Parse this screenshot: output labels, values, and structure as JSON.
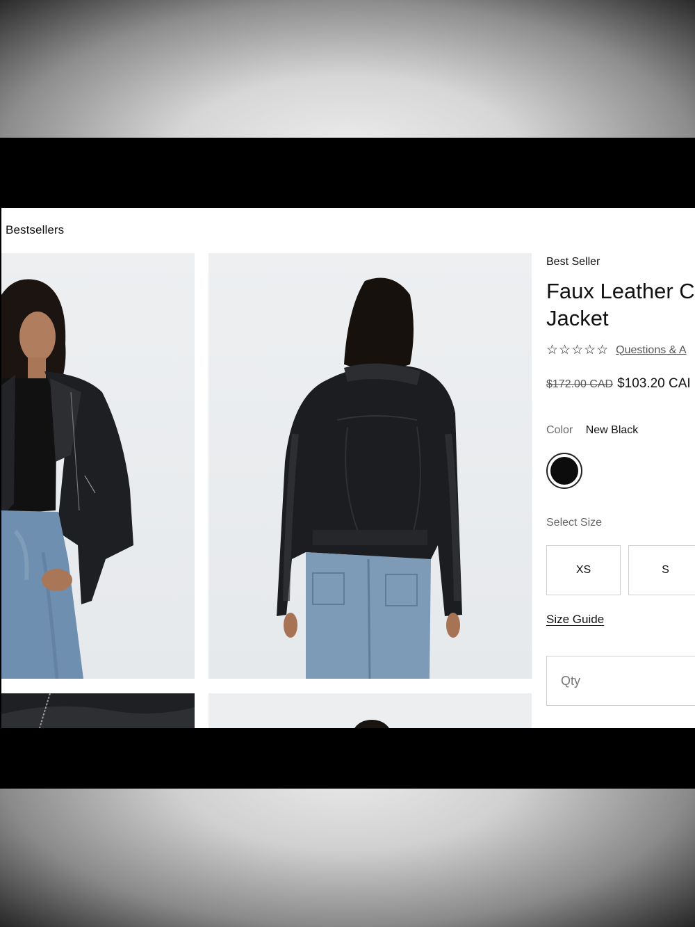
{
  "breadcrumb": {
    "label": "Bestsellers"
  },
  "product": {
    "badge": "Best Seller",
    "title_line1": "Faux Leather C",
    "title_line2": "Jacket",
    "rating_stars": "☆☆☆☆☆",
    "questions_link": "Questions & A",
    "original_price": "$172.00 CAD",
    "sale_price": "$103.20 CAI",
    "color_label": "Color",
    "color_value": "New Black",
    "swatch_color": "#0c0c0c",
    "size_label": "Select Size",
    "sizes": [
      "XS",
      "S"
    ],
    "size_guide": "Size Guide",
    "qty_placeholder": "Qty"
  },
  "gallery": {
    "images": [
      "front-view-model",
      "back-view-model",
      "detail-zipper-closeup",
      "back-partial-view"
    ]
  }
}
